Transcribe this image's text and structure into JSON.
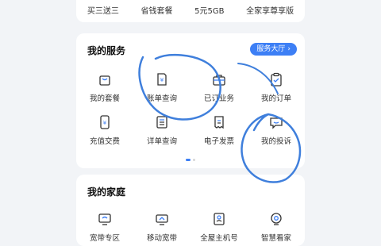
{
  "top_strip": [
    "买三送三",
    "省钱套餐",
    "5元5GB",
    "全家享尊享版"
  ],
  "services": {
    "title": "我的服务",
    "hall_button": "服务大厅",
    "items": [
      {
        "label": "我的套餐",
        "icon": "bag-icon"
      },
      {
        "label": "账单查询",
        "icon": "bill-icon"
      },
      {
        "label": "已订业务",
        "icon": "briefcase-icon"
      },
      {
        "label": "我的订单",
        "icon": "clipboard-icon"
      },
      {
        "label": "充值交费",
        "icon": "phone-yuan-icon"
      },
      {
        "label": "详单查询",
        "icon": "list-icon"
      },
      {
        "label": "电子发票",
        "icon": "invoice-icon"
      },
      {
        "label": "我的投诉",
        "icon": "chat-icon"
      }
    ],
    "pager": {
      "pages": 2,
      "current": 1
    }
  },
  "family": {
    "title": "我的家庭",
    "items": [
      {
        "label": "宽带专区",
        "icon": "monitor-icon"
      },
      {
        "label": "移动宽带",
        "icon": "router-icon"
      },
      {
        "label": "全屋主机号",
        "icon": "id-card-icon"
      },
      {
        "label": "智慧看家",
        "icon": "camera-icon"
      }
    ]
  },
  "colors": {
    "accent": "#3d7ff5",
    "annotation_ink": "#3f7fdc"
  }
}
